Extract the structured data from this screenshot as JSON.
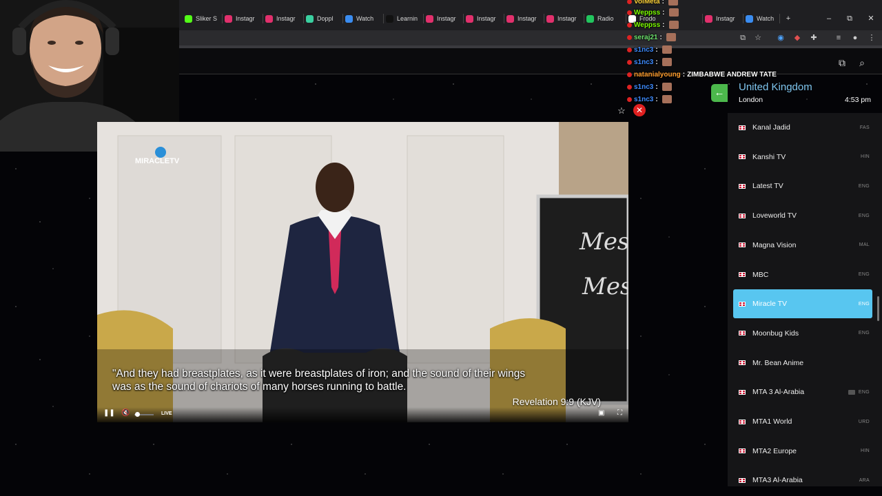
{
  "browser": {
    "tabs": [
      {
        "label": "Sliker S",
        "color": "#53fc18"
      },
      {
        "label": "Instagr",
        "color": "#e1306c"
      },
      {
        "label": "Instagr",
        "color": "#e1306c"
      },
      {
        "label": "Doppl",
        "color": "#3ad0a0"
      },
      {
        "label": "Watch",
        "color": "#3a8cf0"
      },
      {
        "label": "Learnin",
        "color": "#111111"
      },
      {
        "label": "Instagr",
        "color": "#e1306c"
      },
      {
        "label": "Instagr",
        "color": "#e1306c"
      },
      {
        "label": "Instagr",
        "color": "#e1306c"
      },
      {
        "label": "Instagr",
        "color": "#e1306c"
      },
      {
        "label": "Radio",
        "color": "#22c55e"
      },
      {
        "label": "Frodo",
        "color": "#ffffff"
      },
      {
        "label": "Instagr",
        "color": "#e1306c"
      },
      {
        "label": "Watch",
        "color": "#3a8cf0"
      }
    ],
    "new_tab_glyph": "+",
    "minimize_glyph": "–",
    "restore_glyph": "⧉",
    "close_glyph": "✕"
  },
  "chat": [
    {
      "user": "VolMeta",
      "color": "#ffd43b",
      "text": ""
    },
    {
      "user": "Weppss",
      "color": "#7cfc00",
      "text": ""
    },
    {
      "user": "Weppss",
      "color": "#7cfc00",
      "text": ""
    },
    {
      "user": "seraj21",
      "color": "#6ee36e",
      "text": ""
    },
    {
      "user": "s1nc3",
      "color": "#3d8bff",
      "text": ""
    },
    {
      "user": "s1nc3",
      "color": "#3d8bff",
      "text": ""
    },
    {
      "user": "natanialyoung",
      "color": "#ff9d2e",
      "text": "ZIMBABWE ANDREW TATE"
    },
    {
      "user": "s1nc3",
      "color": "#3d8bff",
      "text": ""
    },
    {
      "user": "s1nc3",
      "color": "#3d8bff",
      "text": ""
    }
  ],
  "player": {
    "channel_logo": "MIRACLETV",
    "subtitle_line1": "\"And they had breastplates, as it were breastplates of iron; and the sound of their wings",
    "subtitle_line2": "was as the sound of chariots of many horses running to battle.",
    "verse": "Revelation 9:9 (KJV)",
    "board_text_1": "Messi",
    "board_text_2": "Mess",
    "live_label": "LIVE",
    "volume_level": 0.1
  },
  "sidebar": {
    "country": "United Kingdom",
    "city": "London",
    "time": "4:53 pm",
    "channels": [
      {
        "name": "Kanal Jadid",
        "lang": "FAS",
        "active": false,
        "tv": false
      },
      {
        "name": "Kanshi TV",
        "lang": "HIN",
        "active": false,
        "tv": false
      },
      {
        "name": "Latest TV",
        "lang": "ENG",
        "active": false,
        "tv": false
      },
      {
        "name": "Loveworld TV",
        "lang": "ENG",
        "active": false,
        "tv": false
      },
      {
        "name": "Magna Vision",
        "lang": "MAL",
        "active": false,
        "tv": false
      },
      {
        "name": "MBC",
        "lang": "ENG",
        "active": false,
        "tv": false
      },
      {
        "name": "Miracle TV",
        "lang": "ENG",
        "active": true,
        "tv": false
      },
      {
        "name": "Moonbug Kids",
        "lang": "ENG",
        "active": false,
        "tv": false
      },
      {
        "name": "Mr. Bean Anime",
        "lang": "",
        "active": false,
        "tv": false
      },
      {
        "name": "MTA 3 Al-Arabia",
        "lang": "ENG",
        "active": false,
        "tv": true
      },
      {
        "name": "MTA1 World",
        "lang": "URD",
        "active": false,
        "tv": false
      },
      {
        "name": "MTA2 Europe",
        "lang": "HIN",
        "active": false,
        "tv": false
      },
      {
        "name": "MTA3 Al-Arabia",
        "lang": "ARA",
        "active": false,
        "tv": false
      }
    ]
  }
}
